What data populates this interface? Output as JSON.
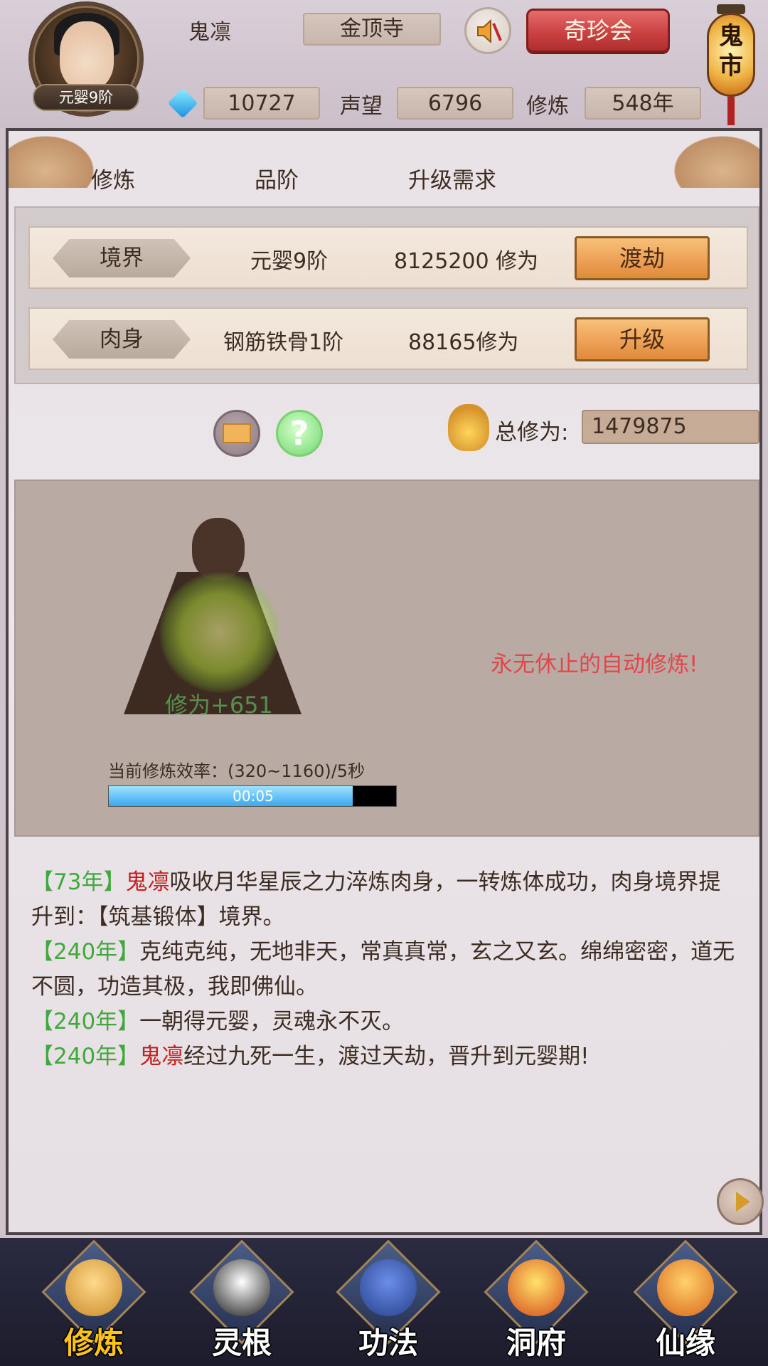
{
  "header": {
    "avatar_rank": "元婴9阶",
    "player_name": "鬼凛",
    "location": "金顶寺",
    "treasure_button": "奇珍会",
    "ghost_market": "鬼市",
    "currency_value": "10727",
    "reputation_label": "声望",
    "reputation_value": "6796",
    "cultivation_label": "修炼",
    "cultivation_value": "548年"
  },
  "table": {
    "headers": [
      "修炼",
      "品阶",
      "升级需求"
    ],
    "rows": [
      {
        "label": "境界",
        "grade": "元婴9阶",
        "requirement": "8125200 修为",
        "button": "渡劫"
      },
      {
        "label": "肉身",
        "grade": "钢筋铁骨1阶",
        "requirement": "88165修为",
        "button": "升级"
      }
    ]
  },
  "totals": {
    "label": "总修为:",
    "value": "1479875"
  },
  "meditation": {
    "gain_text": "修为+651",
    "efficiency": "当前修炼效率：(320~1160)/5秒",
    "progress_text": "00:05",
    "progress_fraction": 0.85,
    "auto_text": "永无休止的自动修炼!"
  },
  "log": [
    {
      "year": "【73年】",
      "name": "鬼凛",
      "text": "吸收月华星辰之力淬炼肉身，一转炼体成功，肉身境界提升到：【筑基锻体】境界。"
    },
    {
      "year": "【240年】",
      "name": "",
      "text": "克纯克纯，无地非天，常真真常，玄之又玄。绵绵密密，道无不圆，功造其极，我即佛仙。"
    },
    {
      "year": "【240年】",
      "name": "",
      "text": "一朝得元婴，灵魂永不灭。"
    },
    {
      "year": "【240年】",
      "name": "鬼凛",
      "text": "经过九死一生，渡过天劫，晋升到元婴期!"
    }
  ],
  "nav": [
    {
      "label": "修炼",
      "icon": "meditating-monk-icon",
      "active": true
    },
    {
      "label": "灵根",
      "icon": "sword-yin-yang-icon",
      "active": false
    },
    {
      "label": "功法",
      "icon": "scroll-book-icon",
      "active": false
    },
    {
      "label": "洞府",
      "icon": "pagoda-icon",
      "active": false
    },
    {
      "label": "仙缘",
      "icon": "gourd-icon",
      "active": false
    }
  ],
  "colors": {
    "accent_red": "#e2464a",
    "year_green": "#3fa93b",
    "name_red": "#c61e1e",
    "nav_active": "#ffc41c"
  }
}
